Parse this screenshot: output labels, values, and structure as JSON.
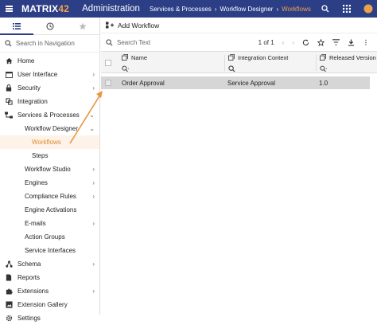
{
  "header": {
    "logo_text": "MATRIX",
    "logo_num": "42",
    "app_title": "Administration",
    "breadcrumbs": [
      "Services & Processes",
      "Workflow Designer",
      "Workflows"
    ],
    "bg_color": "#2b3e86",
    "accent_color": "#f2a24a"
  },
  "sidebar": {
    "search_placeholder": "Search in Navigation",
    "items": [
      {
        "label": "Home",
        "icon": "home-icon"
      },
      {
        "label": "User Interface",
        "icon": "user-interface-icon"
      },
      {
        "label": "Security",
        "icon": "security-icon"
      },
      {
        "label": "Integration",
        "icon": "integration-icon"
      },
      {
        "label": "Services & Processes",
        "icon": "services-icon"
      },
      {
        "label": "Workflow Designer"
      },
      {
        "label": "Workflows"
      },
      {
        "label": "Steps"
      },
      {
        "label": "Workflow Studio"
      },
      {
        "label": "Engines"
      },
      {
        "label": "Compliance Rules"
      },
      {
        "label": "Engine Activations"
      },
      {
        "label": "E-mails"
      },
      {
        "label": "Action Groups"
      },
      {
        "label": "Service Interfaces"
      },
      {
        "label": "Schema",
        "icon": "schema-icon"
      },
      {
        "label": "Reports",
        "icon": "reports-icon"
      },
      {
        "label": "Extensions",
        "icon": "extensions-icon"
      },
      {
        "label": "Extension Gallery",
        "icon": "extension-gallery-icon"
      },
      {
        "label": "Settings",
        "icon": "settings-icon"
      }
    ]
  },
  "main": {
    "add_label": "Add Workflow",
    "search_placeholder": "Search Text",
    "pager": "1 of 1",
    "columns": [
      "Name",
      "Integration Context",
      "Released Version"
    ],
    "rows": [
      {
        "name": "Order Approval",
        "context": "Service Approval",
        "version": "1.0"
      }
    ]
  }
}
